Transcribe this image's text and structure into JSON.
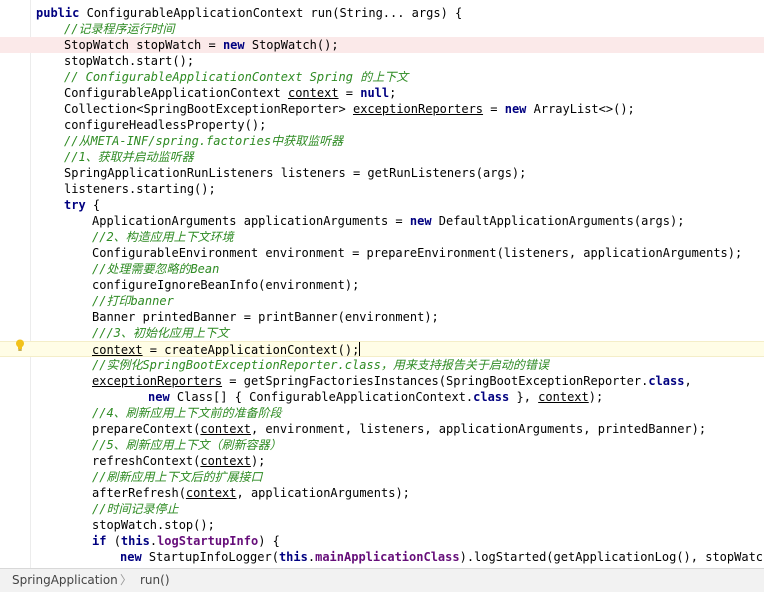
{
  "editor": {
    "lines": [
      [
        {
          "t": "public ",
          "c": "kw"
        },
        {
          "t": "ConfigurableApplicationContext run(String... args) {"
        }
      ],
      [
        {
          "t": "//记录程序运行时间",
          "c": "cm"
        }
      ],
      [
        {
          "t": "StopWatch stopWatch = "
        },
        {
          "t": "new ",
          "c": "kw"
        },
        {
          "t": "StopWatch();"
        }
      ],
      [
        {
          "t": "stopWatch.start();"
        }
      ],
      [
        {
          "t": "// ConfigurableApplicationContext Spring 的上下文",
          "c": "cm"
        }
      ],
      [
        {
          "t": "ConfigurableApplicationContext "
        },
        {
          "t": "context",
          "c": "ul"
        },
        {
          "t": " = "
        },
        {
          "t": "null",
          "c": "kw"
        },
        {
          "t": ";"
        }
      ],
      [
        {
          "t": "Collection<SpringBootExceptionReporter> "
        },
        {
          "t": "exceptionReporters",
          "c": "ul"
        },
        {
          "t": " = "
        },
        {
          "t": "new ",
          "c": "kw"
        },
        {
          "t": "ArrayList<>();"
        }
      ],
      [
        {
          "t": "configureHeadlessProperty();"
        }
      ],
      [
        {
          "t": "//从META-INF/spring.factories中获取监听器",
          "c": "cm"
        }
      ],
      [
        {
          "t": "//1、获取并启动监听器",
          "c": "cm"
        }
      ],
      [
        {
          "t": "SpringApplicationRunListeners listeners = getRunListeners(args);"
        }
      ],
      [
        {
          "t": "listeners.starting();"
        }
      ],
      [
        {
          "t": "try ",
          "c": "kw"
        },
        {
          "t": "{"
        }
      ],
      [
        {
          "t": "ApplicationArguments applicationArguments = "
        },
        {
          "t": "new ",
          "c": "kw"
        },
        {
          "t": "DefaultApplicationArguments(args);"
        }
      ],
      [
        {
          "t": "//2、构造应用上下文环境",
          "c": "cm"
        }
      ],
      [
        {
          "t": "ConfigurableEnvironment environment = prepareEnvironment(listeners, applicationArguments);"
        }
      ],
      [
        {
          "t": "//处理需要忽略的Bean",
          "c": "cm"
        }
      ],
      [
        {
          "t": "configureIgnoreBeanInfo(environment);"
        }
      ],
      [
        {
          "t": "//打印banner",
          "c": "cm"
        }
      ],
      [
        {
          "t": "Banner printedBanner = printBanner(environment);"
        }
      ],
      [
        {
          "t": "///3、初始化应用上下文",
          "c": "cm"
        }
      ],
      [
        {
          "t": "context",
          "c": "ul"
        },
        {
          "t": " = createApplicationContext();"
        }
      ],
      [
        {
          "t": "//实例化SpringBootExceptionReporter.class，用来支持报告关于启动的错误",
          "c": "cm"
        }
      ],
      [
        {
          "t": "exceptionReporters",
          "c": "ul"
        },
        {
          "t": " = getSpringFactoriesInstances(SpringBootExceptionReporter."
        },
        {
          "t": "class",
          "c": "kw"
        },
        {
          "t": ","
        }
      ],
      [
        {
          "t": "new ",
          "c": "kw"
        },
        {
          "t": "Class[] { ConfigurableApplicationContext."
        },
        {
          "t": "class ",
          "c": "kw"
        },
        {
          "t": "}, "
        },
        {
          "t": "context",
          "c": "ul"
        },
        {
          "t": ");"
        }
      ],
      [
        {
          "t": "//4、刷新应用上下文前的准备阶段",
          "c": "cm"
        }
      ],
      [
        {
          "t": "prepareContext("
        },
        {
          "t": "context",
          "c": "ul"
        },
        {
          "t": ", environment, listeners, applicationArguments, printedBanner);"
        }
      ],
      [
        {
          "t": "//5、刷新应用上下文（刷新容器）",
          "c": "cm"
        }
      ],
      [
        {
          "t": "refreshContext("
        },
        {
          "t": "context",
          "c": "ul"
        },
        {
          "t": ");"
        }
      ],
      [
        {
          "t": "//刷新应用上下文后的扩展接口",
          "c": "cm"
        }
      ],
      [
        {
          "t": "afterRefresh("
        },
        {
          "t": "context",
          "c": "ul"
        },
        {
          "t": ", applicationArguments);"
        }
      ],
      [
        {
          "t": "//时间记录停止",
          "c": "cm"
        }
      ],
      [
        {
          "t": "stopWatch.stop();"
        }
      ],
      [
        {
          "t": "if ",
          "c": "kw"
        },
        {
          "t": "("
        },
        {
          "t": "this",
          "c": "kw"
        },
        {
          "t": "."
        },
        {
          "t": "logStartupInfo",
          "c": "fld"
        },
        {
          "t": ") {"
        }
      ],
      [
        {
          "t": "new ",
          "c": "kw"
        },
        {
          "t": "StartupInfoLogger("
        },
        {
          "t": "this",
          "c": "kw"
        },
        {
          "t": "."
        },
        {
          "t": "mainApplicationClass",
          "c": "fld"
        },
        {
          "t": ").logStarted(getApplicationLog(), stopWatch);"
        }
      ]
    ],
    "indents": [
      0,
      1,
      1,
      1,
      1,
      1,
      1,
      1,
      1,
      1,
      1,
      1,
      1,
      2,
      2,
      2,
      2,
      2,
      2,
      2,
      2,
      2,
      2,
      2,
      4,
      2,
      2,
      2,
      2,
      2,
      2,
      2,
      2,
      2,
      3
    ],
    "highlighted_line": 2,
    "current_line": 21,
    "caret_line": 21,
    "bulb_icon": "lightbulb-icon"
  },
  "statusbar": {
    "breadcrumb": [
      "SpringApplication",
      "run()"
    ],
    "separator": "〉"
  }
}
